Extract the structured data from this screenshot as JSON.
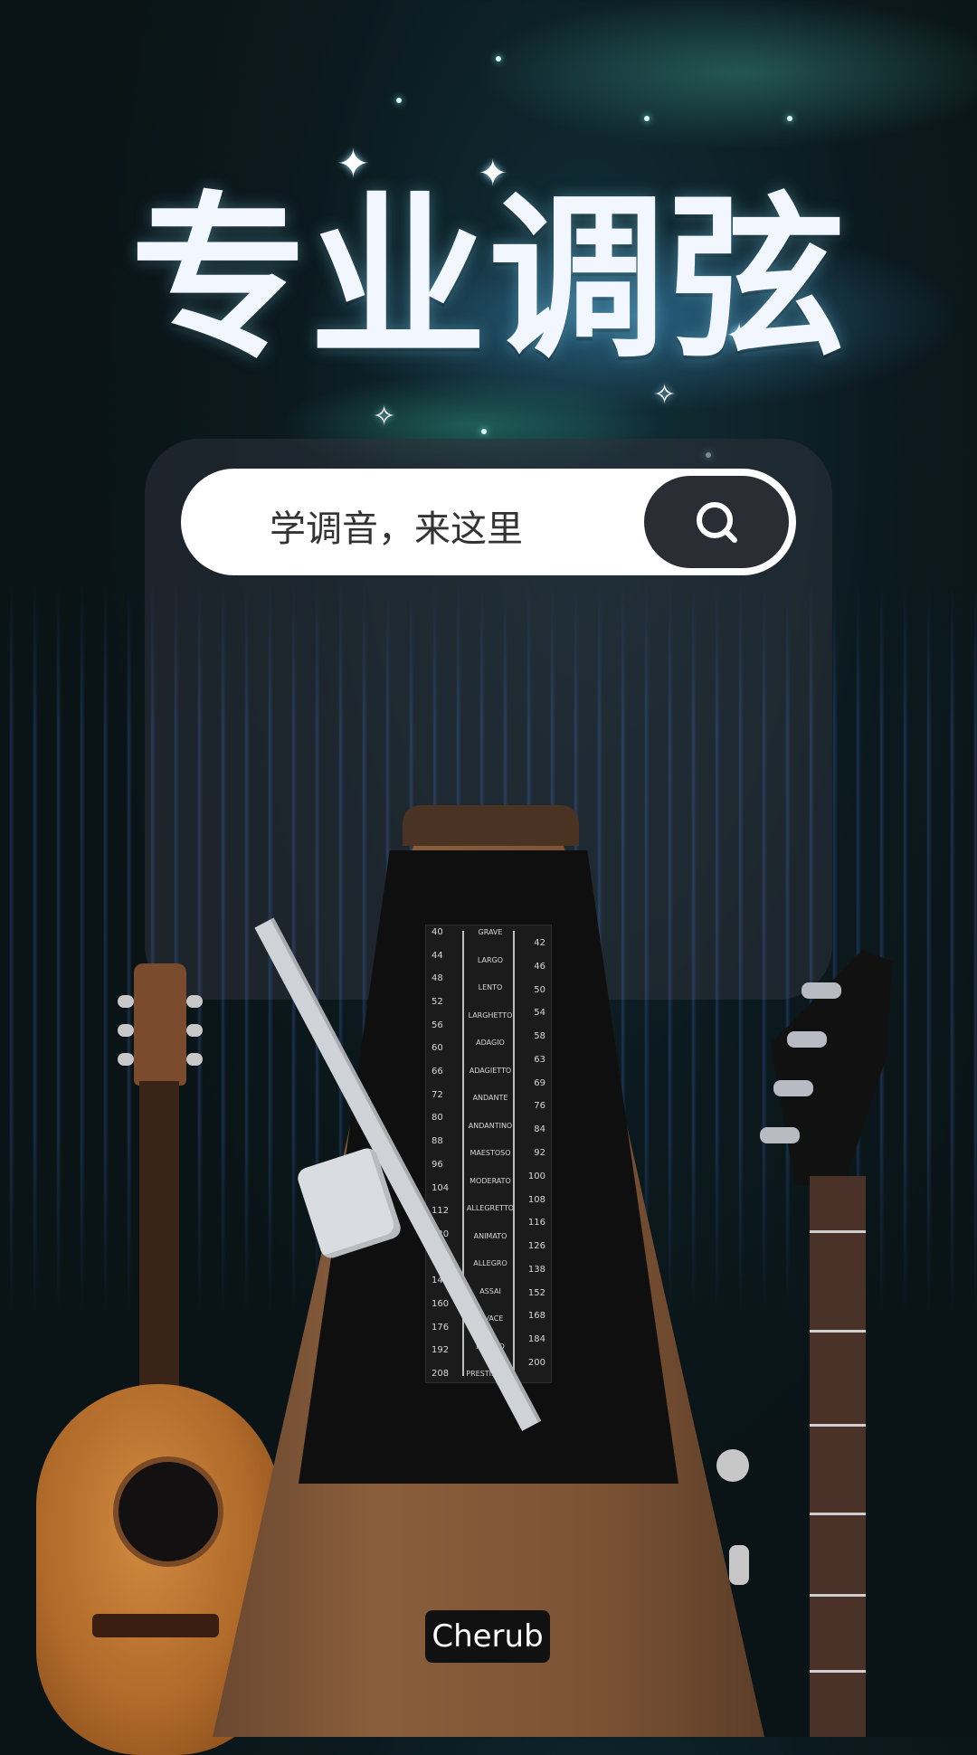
{
  "header": {
    "title": "专业调弦"
  },
  "search": {
    "placeholder": "学调音，来这里",
    "button_icon": "search-icon"
  },
  "metronome": {
    "brand": "Cherub",
    "scale_left": [
      "40",
      "44",
      "48",
      "52",
      "56",
      "60",
      "66",
      "72",
      "80",
      "88",
      "96",
      "104",
      "112",
      "120",
      "132",
      "144",
      "160",
      "176",
      "192",
      "208"
    ],
    "scale_right": [
      "42",
      "46",
      "50",
      "54",
      "58",
      "63",
      "69",
      "76",
      "84",
      "92",
      "100",
      "108",
      "116",
      "126",
      "138",
      "152",
      "168",
      "184",
      "200"
    ],
    "tempo_names": [
      "GRAVE",
      "LARGO",
      "LENTO",
      "LARGHETTO",
      "ADAGIO",
      "ADAGIETTO",
      "ANDANTE",
      "ANDANTINO",
      "MAESTOSO",
      "MODERATO",
      "ALLEGRETTO",
      "ANIMATO",
      "ALLEGRO",
      "ASSAI",
      "VIVACE",
      "PRESTO",
      "PRESTISSIMO"
    ]
  },
  "colors": {
    "background": "#0a1417",
    "search_bg": "#ffffff",
    "search_button": "#2a2d33",
    "title": "#f2f7ff"
  }
}
